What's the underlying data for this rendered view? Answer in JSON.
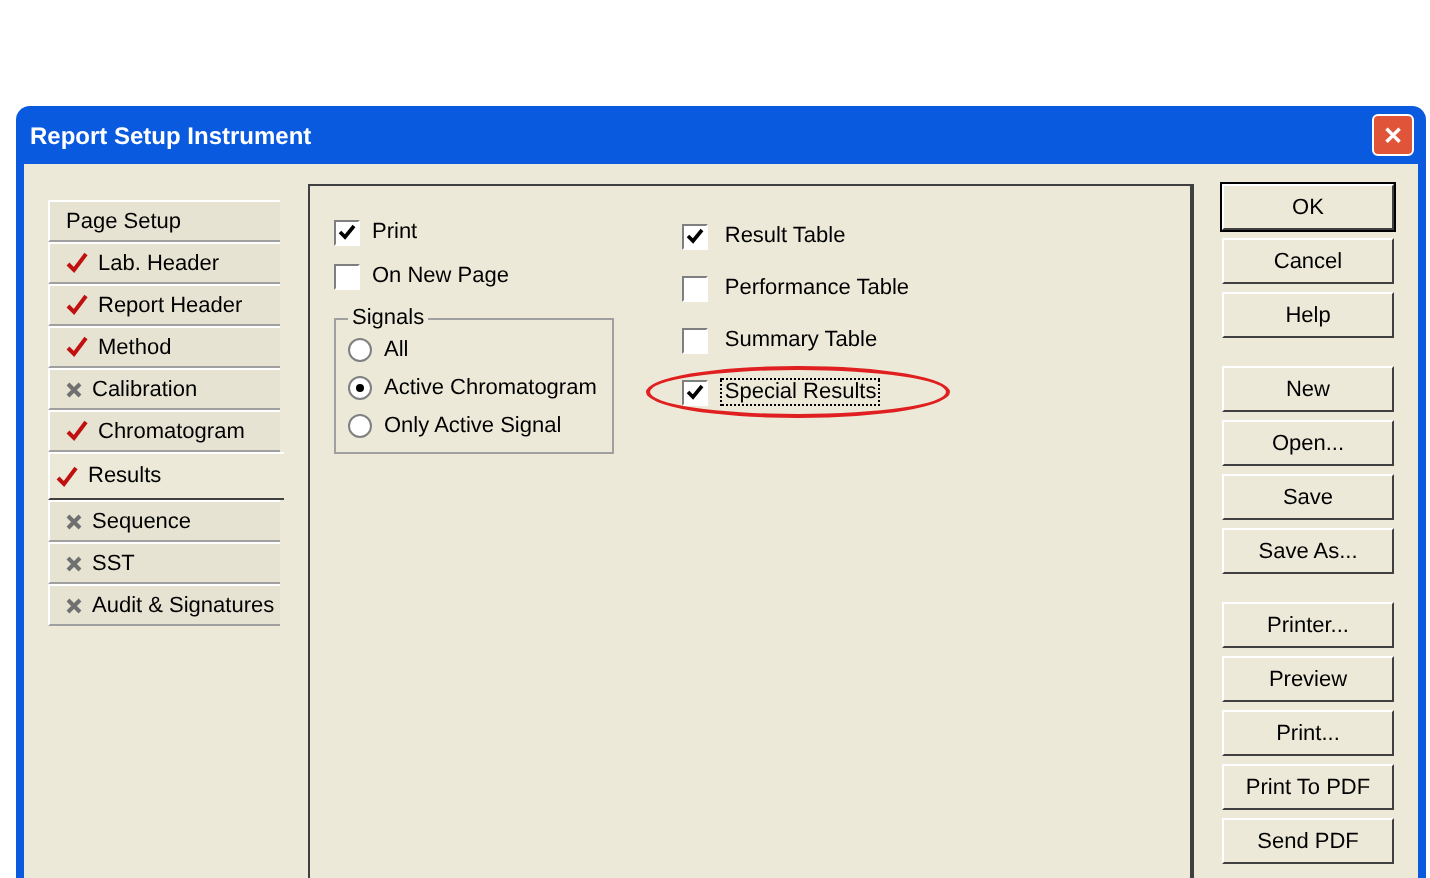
{
  "window": {
    "title": "Report Setup Instrument",
    "close_label": "✕"
  },
  "tabs": [
    {
      "label": "Page Setup",
      "kind": "plain",
      "selected": false
    },
    {
      "label": "Lab. Header",
      "kind": "ticked",
      "selected": false
    },
    {
      "label": "Report Header",
      "kind": "ticked",
      "selected": false
    },
    {
      "label": "Method",
      "kind": "ticked",
      "selected": false
    },
    {
      "label": "Calibration",
      "kind": "crossed",
      "selected": false
    },
    {
      "label": "Chromatogram",
      "kind": "ticked",
      "selected": false
    },
    {
      "label": "Results",
      "kind": "ticked",
      "selected": true
    },
    {
      "label": "Sequence",
      "kind": "crossed",
      "selected": false
    },
    {
      "label": "SST",
      "kind": "crossed",
      "selected": false
    },
    {
      "label": "Audit & Signatures",
      "kind": "crossed",
      "selected": false
    }
  ],
  "left_options": [
    {
      "label": "Print",
      "checked": true
    },
    {
      "label": "On New Page",
      "checked": false
    }
  ],
  "signals": {
    "title": "Signals",
    "options": [
      {
        "label": "All",
        "selected": false
      },
      {
        "label": "Active Chromatogram",
        "selected": true
      },
      {
        "label": "Only Active Signal",
        "selected": false
      }
    ]
  },
  "right_options": [
    {
      "label": "Result Table",
      "checked": true,
      "highlighted": false
    },
    {
      "label": "Performance Table",
      "checked": false,
      "highlighted": false
    },
    {
      "label": "Summary Table",
      "checked": false,
      "highlighted": false
    },
    {
      "label": "Special Results",
      "checked": true,
      "highlighted": true
    }
  ],
  "button_groups": [
    [
      "OK",
      "Cancel",
      "Help"
    ],
    [
      "New",
      "Open...",
      "Save",
      "Save As..."
    ],
    [
      "Printer...",
      "Preview",
      "Print...",
      "Print To PDF",
      "Send PDF"
    ]
  ]
}
